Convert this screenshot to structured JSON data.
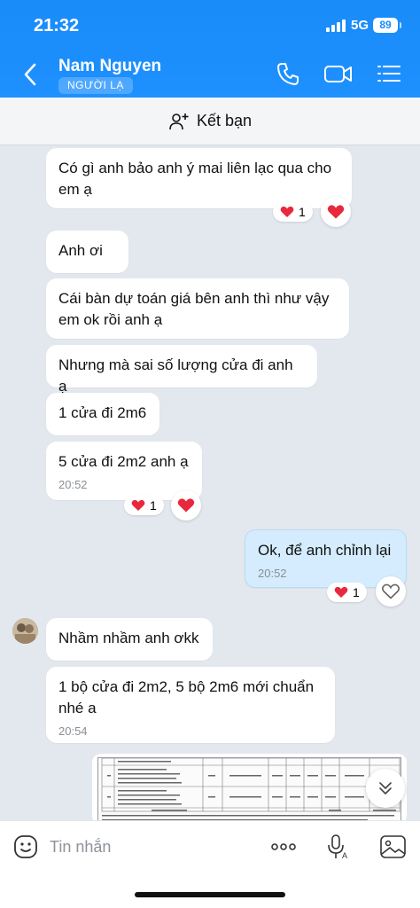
{
  "status_bar": {
    "time": "21:32",
    "network": "5G",
    "battery": "89"
  },
  "header": {
    "contact_name": "Nam Nguyen",
    "badge": "NGƯỜI LẠ",
    "icons": [
      "back-chevron-icon",
      "phone-icon",
      "video-icon",
      "menu-icon"
    ]
  },
  "add_friend": {
    "label": "Kết bạn"
  },
  "messages": [
    {
      "text": "Có gì anh bảo anh ý mai liên lạc qua cho em ạ",
      "sender": "them",
      "reaction": "❤",
      "reaction_count": "1"
    },
    {
      "text": "Anh ơi",
      "sender": "them"
    },
    {
      "text": "Cái bàn dự toán giá bên anh thì như vậy em ok rồi anh ạ",
      "sender": "them"
    },
    {
      "text": "Nhưng mà sai số lượng cửa đi anh ạ",
      "sender": "them"
    },
    {
      "text": "1 cửa đi 2m6",
      "sender": "them"
    },
    {
      "text": "5 cửa đi 2m2 anh ạ",
      "sender": "them",
      "time": "20:52",
      "reaction": "❤",
      "reaction_count": "1"
    },
    {
      "text": "Ok, để anh chỉnh lại",
      "sender": "me",
      "time": "20:52",
      "reaction": "❤",
      "reaction_count": "1"
    },
    {
      "text": "Nhầm nhầm anh ơkk",
      "sender": "them"
    },
    {
      "text": "1 bộ cửa đi 2m2, 5 bộ 2m6 mới chuẩn nhé a",
      "sender": "them",
      "time": "20:54"
    }
  ],
  "input_bar": {
    "placeholder": "Tin nhắn",
    "icons": [
      "sticker-icon",
      "more-icon",
      "voice-icon",
      "image-icon"
    ]
  },
  "colors": {
    "header_blue": "#1a8cf8",
    "my_bubble": "#d4ecfd",
    "heart_red": "#e8283d"
  }
}
